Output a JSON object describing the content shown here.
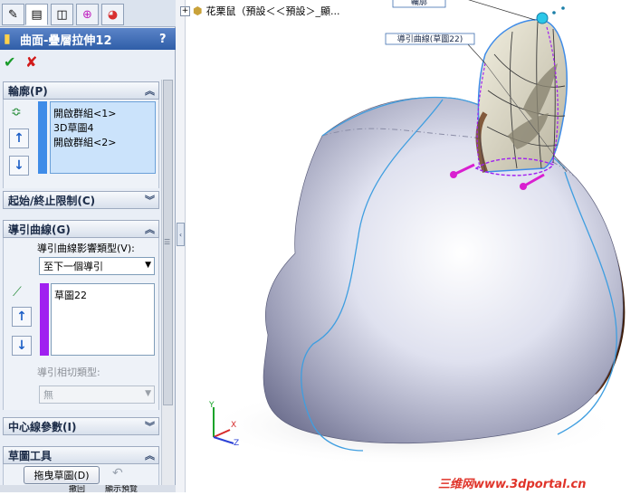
{
  "tabs": [
    {
      "icon": "feature-manager-icon",
      "glyph": "✎"
    },
    {
      "icon": "property-manager-icon",
      "glyph": "▤"
    },
    {
      "icon": "configuration-manager-icon",
      "glyph": "◫"
    },
    {
      "icon": "dimxpert-icon",
      "glyph": "⊕"
    },
    {
      "icon": "display-manager-icon",
      "glyph": "◕"
    }
  ],
  "title": "曲面-疊層拉伸12",
  "help": "?",
  "actions": {
    "ok": "✔",
    "cancel": "✘"
  },
  "profile": {
    "header": "輪廓(P)",
    "items": [
      "開啟群組<1>",
      "3D草圖4",
      "開啟群組<2>"
    ]
  },
  "constraints": {
    "header": "起始/終止限制(C)"
  },
  "guide": {
    "header": "導引曲線(G)",
    "influence_label": "導引曲線影響類型(V):",
    "influence_value": "至下一個導引",
    "items": [
      "草圖22"
    ],
    "tangency_label": "導引相切類型:",
    "tangency_value": "無"
  },
  "centerline": {
    "header": "中心線參數(I)"
  },
  "sketch_tools": {
    "header": "草圖工具",
    "drag_button": "拖曳草圖(D)"
  },
  "bottom_tabs": [
    "撤回",
    "顯示預覽"
  ],
  "tree": {
    "expander": "+",
    "text": "花栗鼠（預設＜＜預設＞_顯..."
  },
  "callouts": {
    "top": "輪廓",
    "guide": "導引曲線(草圖22)"
  },
  "triad": {
    "x": "X",
    "y": "Y",
    "z": "Z"
  },
  "watermark": "三维网www.3dportal.cn",
  "colors": {
    "accent_blue": "#3f8ce8",
    "guide_purple": "#a020f0",
    "magenta": "#d91fd0",
    "body_rim": "#5a2c10"
  }
}
